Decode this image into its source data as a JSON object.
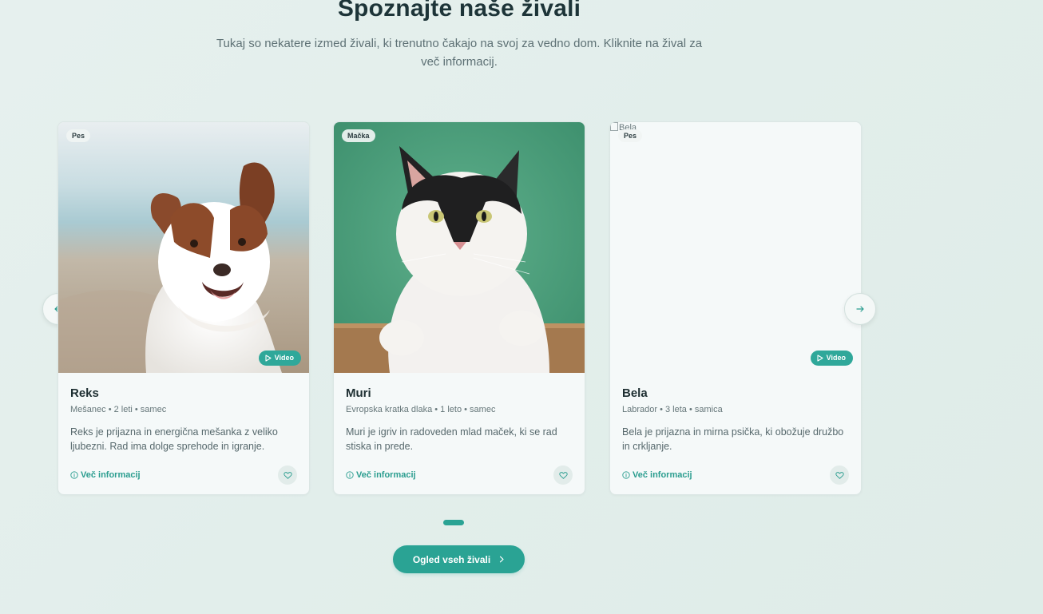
{
  "section": {
    "title": "Spoznajte naše živali",
    "subtitle": "Tukaj so nekatere izmed živali, ki trenutno čakajo na svoj za vedno dom. Kliknite na žival za več informacij."
  },
  "carousel": {
    "prev_icon": "arrow-left-icon",
    "next_icon": "arrow-right-icon",
    "page_count": 1,
    "active_page": 1
  },
  "animals": [
    {
      "type": "Pes",
      "name": "Reks",
      "meta": "Mešanec • 2 leti • samec",
      "description": "Reks je prijazna in energična mešanka z veliko ljubezni. Rad ima dolge sprehode in igranje.",
      "has_video": true,
      "video_label": "Video",
      "more_label": "Več informacij",
      "image": "dog-photo"
    },
    {
      "type": "Mačka",
      "name": "Muri",
      "meta": "Evropska kratka dlaka • 1 leto • samec",
      "description": "Muri je igriv in radoveden mlad maček, ki se rad stiska in prede.",
      "has_video": false,
      "more_label": "Več informacij",
      "image": "cat-photo"
    },
    {
      "type": "Pes",
      "name": "Bela",
      "meta": "Labrador • 3 leta • samica",
      "description": "Bela je prijazna in mirna psička, ki obožuje družbo in crkljanje.",
      "has_video": true,
      "video_label": "Video",
      "more_label": "Več informacij",
      "image": "broken-image",
      "image_alt": "Bela"
    }
  ],
  "cta": {
    "label": "Ogled vseh živali",
    "icon": "chevron-right-icon"
  },
  "colors": {
    "accent": "#2aa394",
    "heading": "#1d3438",
    "background": "#e2eeeb"
  }
}
